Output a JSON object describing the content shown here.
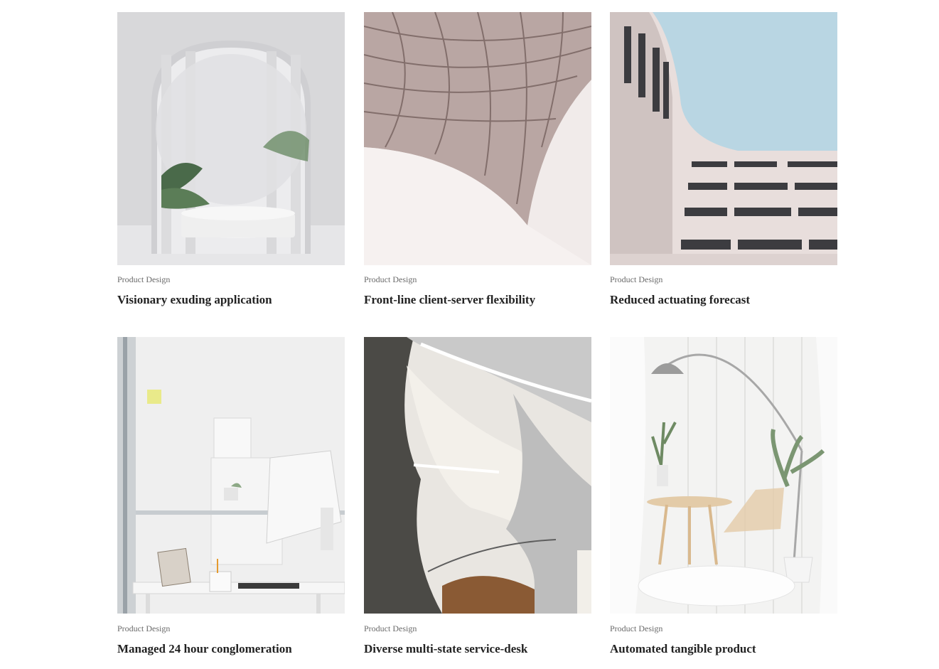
{
  "gallery": {
    "items": [
      {
        "category": "Product Design",
        "title": "Visionary exuding application",
        "image": "arch-podium-plant-image"
      },
      {
        "category": "Product Design",
        "title": "Front-line client-server flexibility",
        "image": "lattice-roof-image"
      },
      {
        "category": "Product Design",
        "title": "Reduced actuating forecast",
        "image": "curved-building-sky-image"
      },
      {
        "category": "Product Design",
        "title": "Managed 24 hour conglomeration",
        "image": "white-office-desk-image"
      },
      {
        "category": "Product Design",
        "title": "Diverse multi-state service-desk",
        "image": "white-staircase-image"
      },
      {
        "category": "Product Design",
        "title": "Automated tangible product",
        "image": "white-room-lamp-image"
      }
    ]
  }
}
